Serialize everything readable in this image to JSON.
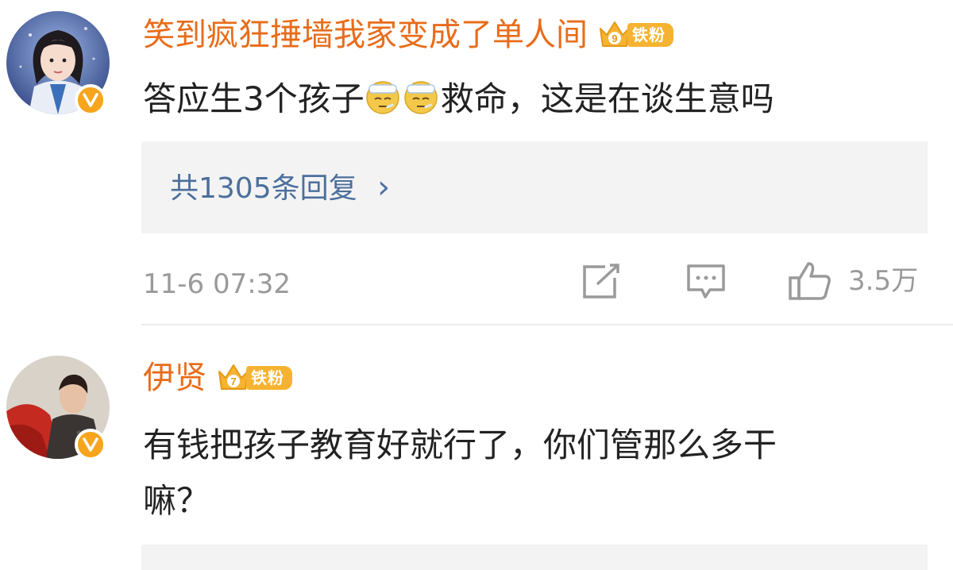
{
  "comments": [
    {
      "username": "笑到疯狂捶墙我家变成了单人间",
      "fan_badge": "铁粉",
      "fan_level": "9",
      "text_before_emoji": "答应生3个孩子",
      "emoji": [
        "sick-face-icon",
        "sick-face-icon"
      ],
      "text_after_emoji": "救命，这是在谈生意吗",
      "reply_summary": "共1305条回复",
      "reply_arrow": "›",
      "timestamp": "11-6 07:32",
      "like_count": "3.5万"
    },
    {
      "username": "伊贤",
      "fan_badge": "铁粉",
      "fan_level": "7",
      "text_line1": "有钱把孩子教育好就行了，你们管那么多干",
      "text_line2": "嘛？"
    }
  ],
  "colors": {
    "username": "#e86c1a",
    "verified_badge": "#f7a51c",
    "fan_badge": "#f6b331",
    "reply_link": "#4c6f9c",
    "meta_gray": "#9a9a9a",
    "reply_bg": "#f3f3f3"
  }
}
